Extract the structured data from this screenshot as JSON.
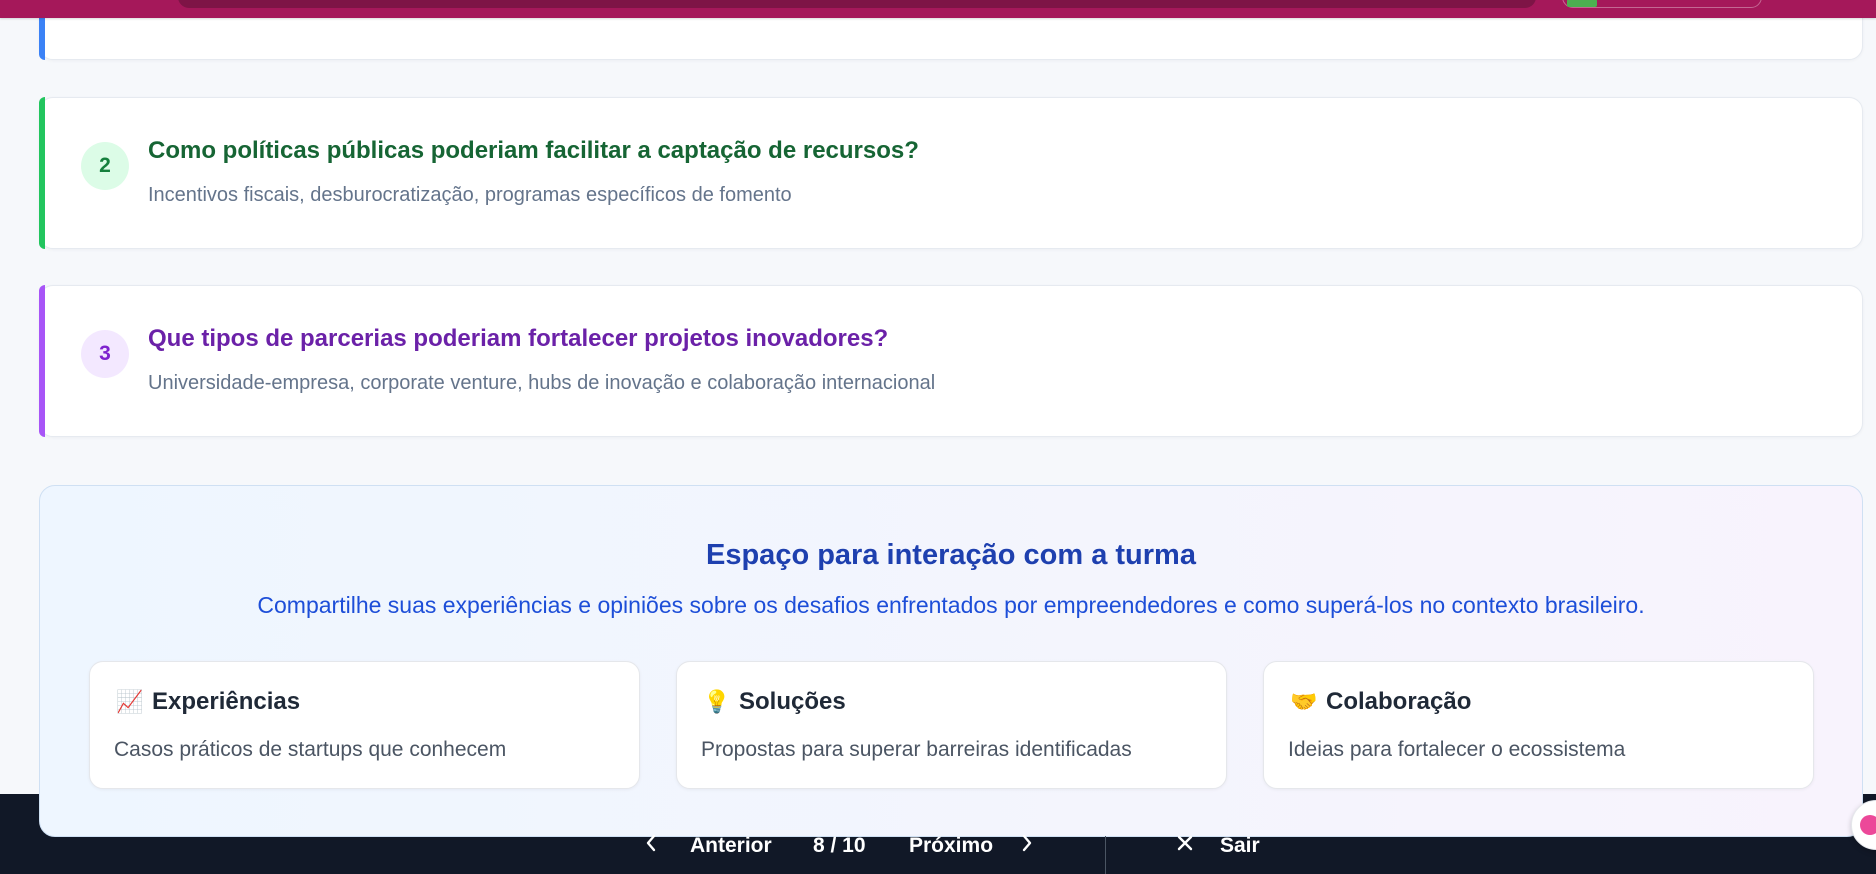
{
  "questions": [
    {
      "number": "2",
      "title": "Como políticas públicas poderiam facilitar a captação de recursos?",
      "description": "Incentivos fiscais, desburocratização, programas específicos de fomento",
      "accent": "#22c55e"
    },
    {
      "number": "3",
      "title": "Que tipos de parcerias poderiam fortalecer projetos inovadores?",
      "description": "Universidade-empresa, corporate venture, hubs de inovação e colaboração internacional",
      "accent": "#a855f7"
    }
  ],
  "interaction": {
    "title": "Espaço para interação com a turma",
    "subtitle": "Compartilhe suas experiências e opiniões sobre os desafios enfrentados por empreendedores e como superá-los no contexto brasileiro.",
    "cards": [
      {
        "emoji": "📈",
        "icon": "chart-increasing-icon",
        "title": "Experiências",
        "description": "Casos práticos de startups que conhecem"
      },
      {
        "emoji": "💡",
        "icon": "light-bulb-icon",
        "title": "Soluções",
        "description": "Propostas para superar barreiras identificadas"
      },
      {
        "emoji": "🤝",
        "icon": "handshake-icon",
        "title": "Colaboração",
        "description": "Ideias para fortalecer o ecossistema"
      }
    ]
  },
  "navigation": {
    "prev_label": "Anterior",
    "page_indicator": "8 / 10",
    "next_label": "Próximo",
    "exit_label": "Sair"
  },
  "colors": {
    "header": "#a5185a",
    "bottom_bar": "#111827",
    "partial_card_accent": "#3b82f6"
  }
}
